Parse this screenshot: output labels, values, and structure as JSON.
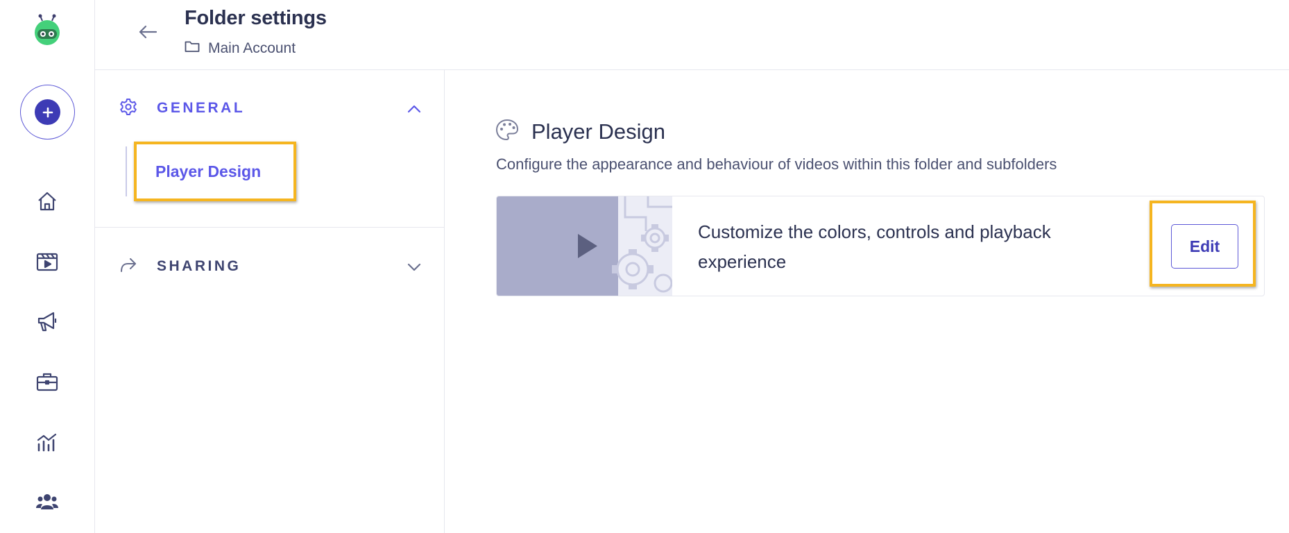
{
  "header": {
    "title": "Folder settings",
    "breadcrumb": "Main Account"
  },
  "rail": {
    "items": [
      {
        "icon": "home-icon"
      },
      {
        "icon": "videos-icon"
      },
      {
        "icon": "megaphone-icon"
      },
      {
        "icon": "briefcase-icon"
      },
      {
        "icon": "analytics-icon"
      },
      {
        "icon": "team-icon"
      }
    ]
  },
  "nav": {
    "general": {
      "label": "GENERAL",
      "icon": "gear-icon",
      "expanded": true
    },
    "player_design": {
      "label": "Player Design"
    },
    "sharing": {
      "label": "SHARING",
      "icon": "share-icon",
      "expanded": false
    }
  },
  "main": {
    "title": "Player Design",
    "description": "Configure the appearance and behaviour of videos within this folder and subfolders",
    "card_text": "Customize the colors, controls and playback experience",
    "edit_label": "Edit"
  },
  "colors": {
    "accent": "#5b57e8",
    "primary_dark": "#3d3bb5",
    "highlight": "#f5b520",
    "logo_green": "#3ecf8e"
  }
}
